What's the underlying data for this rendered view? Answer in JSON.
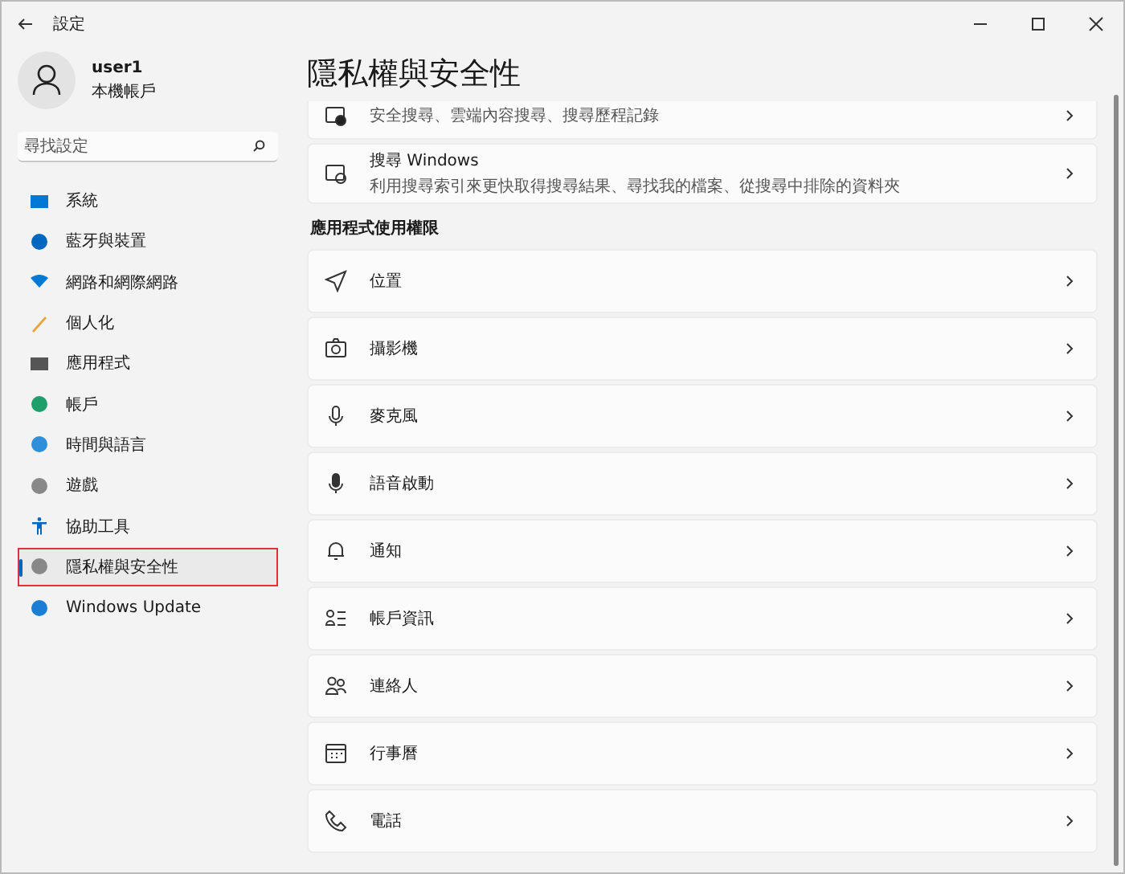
{
  "window": {
    "title": "設定"
  },
  "user": {
    "name": "user1",
    "account": "本機帳戶"
  },
  "search": {
    "placeholder": "尋找設定"
  },
  "sidebar": {
    "items": [
      {
        "label": "系統",
        "selected": false
      },
      {
        "label": "藍牙與裝置",
        "selected": false
      },
      {
        "label": "網路和網際網路",
        "selected": false
      },
      {
        "label": "個人化",
        "selected": false
      },
      {
        "label": "應用程式",
        "selected": false
      },
      {
        "label": "帳戶",
        "selected": false
      },
      {
        "label": "時間與語言",
        "selected": false
      },
      {
        "label": "遊戲",
        "selected": false
      },
      {
        "label": "協助工具",
        "selected": false
      },
      {
        "label": "隱私權與安全性",
        "selected": true
      },
      {
        "label": "Windows Update",
        "selected": false
      }
    ]
  },
  "page": {
    "title": "隱私權與安全性",
    "top_cards": [
      {
        "subtitle": "安全搜尋、雲端內容搜尋、搜尋歷程記錄"
      },
      {
        "title": "搜尋 Windows",
        "subtitle": "利用搜尋索引來更快取得搜尋結果、尋找我的檔案、從搜尋中排除的資料夾"
      }
    ],
    "section": "應用程式使用權限",
    "permissions": [
      {
        "label": "位置"
      },
      {
        "label": "攝影機"
      },
      {
        "label": "麥克風"
      },
      {
        "label": "語音啟動"
      },
      {
        "label": "通知"
      },
      {
        "label": "帳戶資訊"
      },
      {
        "label": "連絡人"
      },
      {
        "label": "行事曆"
      },
      {
        "label": "電話"
      }
    ]
  }
}
